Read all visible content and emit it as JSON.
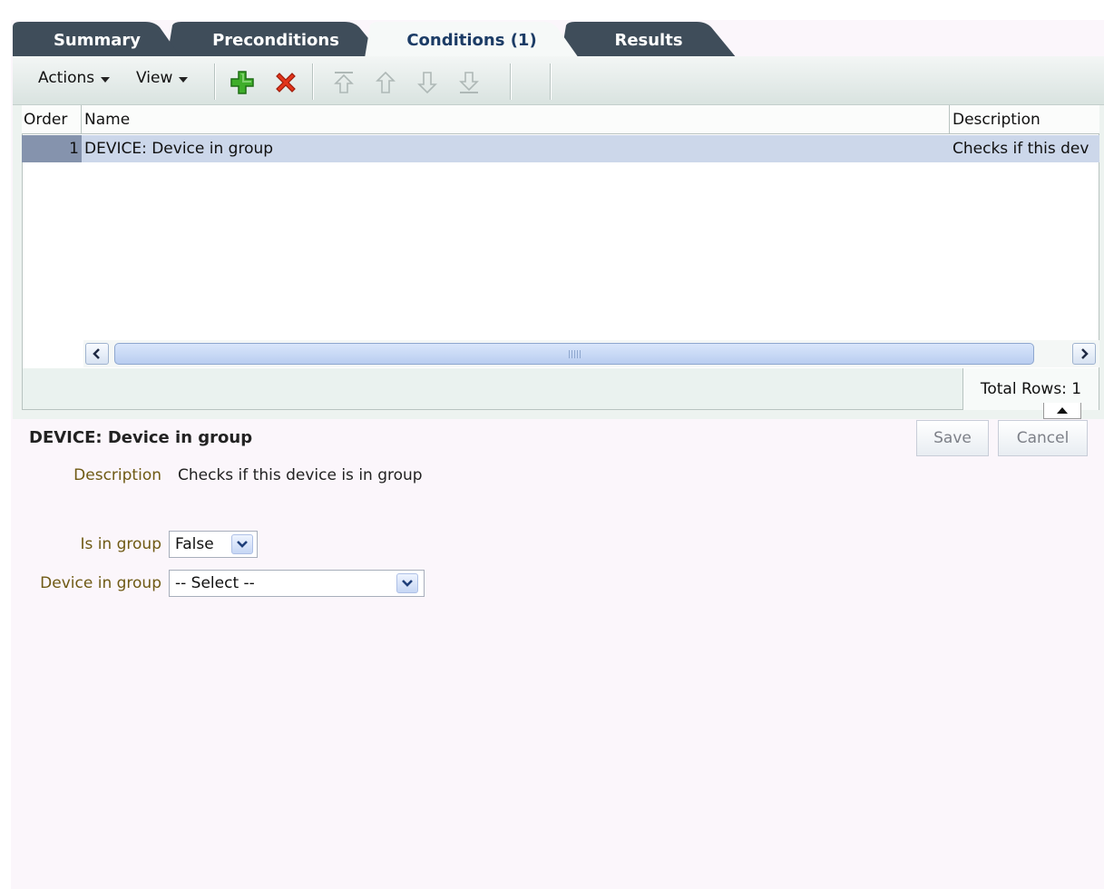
{
  "tabs": [
    {
      "label": "Summary",
      "active": false
    },
    {
      "label": "Preconditions",
      "active": false
    },
    {
      "label": "Conditions (1)",
      "active": true
    },
    {
      "label": "Results",
      "active": false
    }
  ],
  "toolbar": {
    "actions_label": "Actions",
    "view_label": "View",
    "icons": [
      "add-icon",
      "delete-icon",
      "move-top-icon",
      "move-up-icon",
      "move-down-icon",
      "move-bottom-icon"
    ]
  },
  "table": {
    "columns": [
      "Order",
      "Name",
      "Description"
    ],
    "rows": [
      {
        "order": "1",
        "name": "DEVICE: Device in group",
        "description": "Checks if this dev"
      }
    ],
    "total_rows": "Total Rows: 1"
  },
  "detail": {
    "title": "DEVICE: Device in group",
    "save_label": "Save",
    "cancel_label": "Cancel",
    "description_label": "Description",
    "description_value": "Checks if this device is in group",
    "is_in_group_label": "Is in group",
    "is_in_group_value": "False",
    "device_in_group_label": "Device in group",
    "device_in_group_value": "-- Select --"
  },
  "colors": {
    "tab_dark": "#3a4a5a",
    "tab_active": "#f6f9f8",
    "selected_row": "#ccd7ea",
    "label_color": "#6f5a14"
  }
}
